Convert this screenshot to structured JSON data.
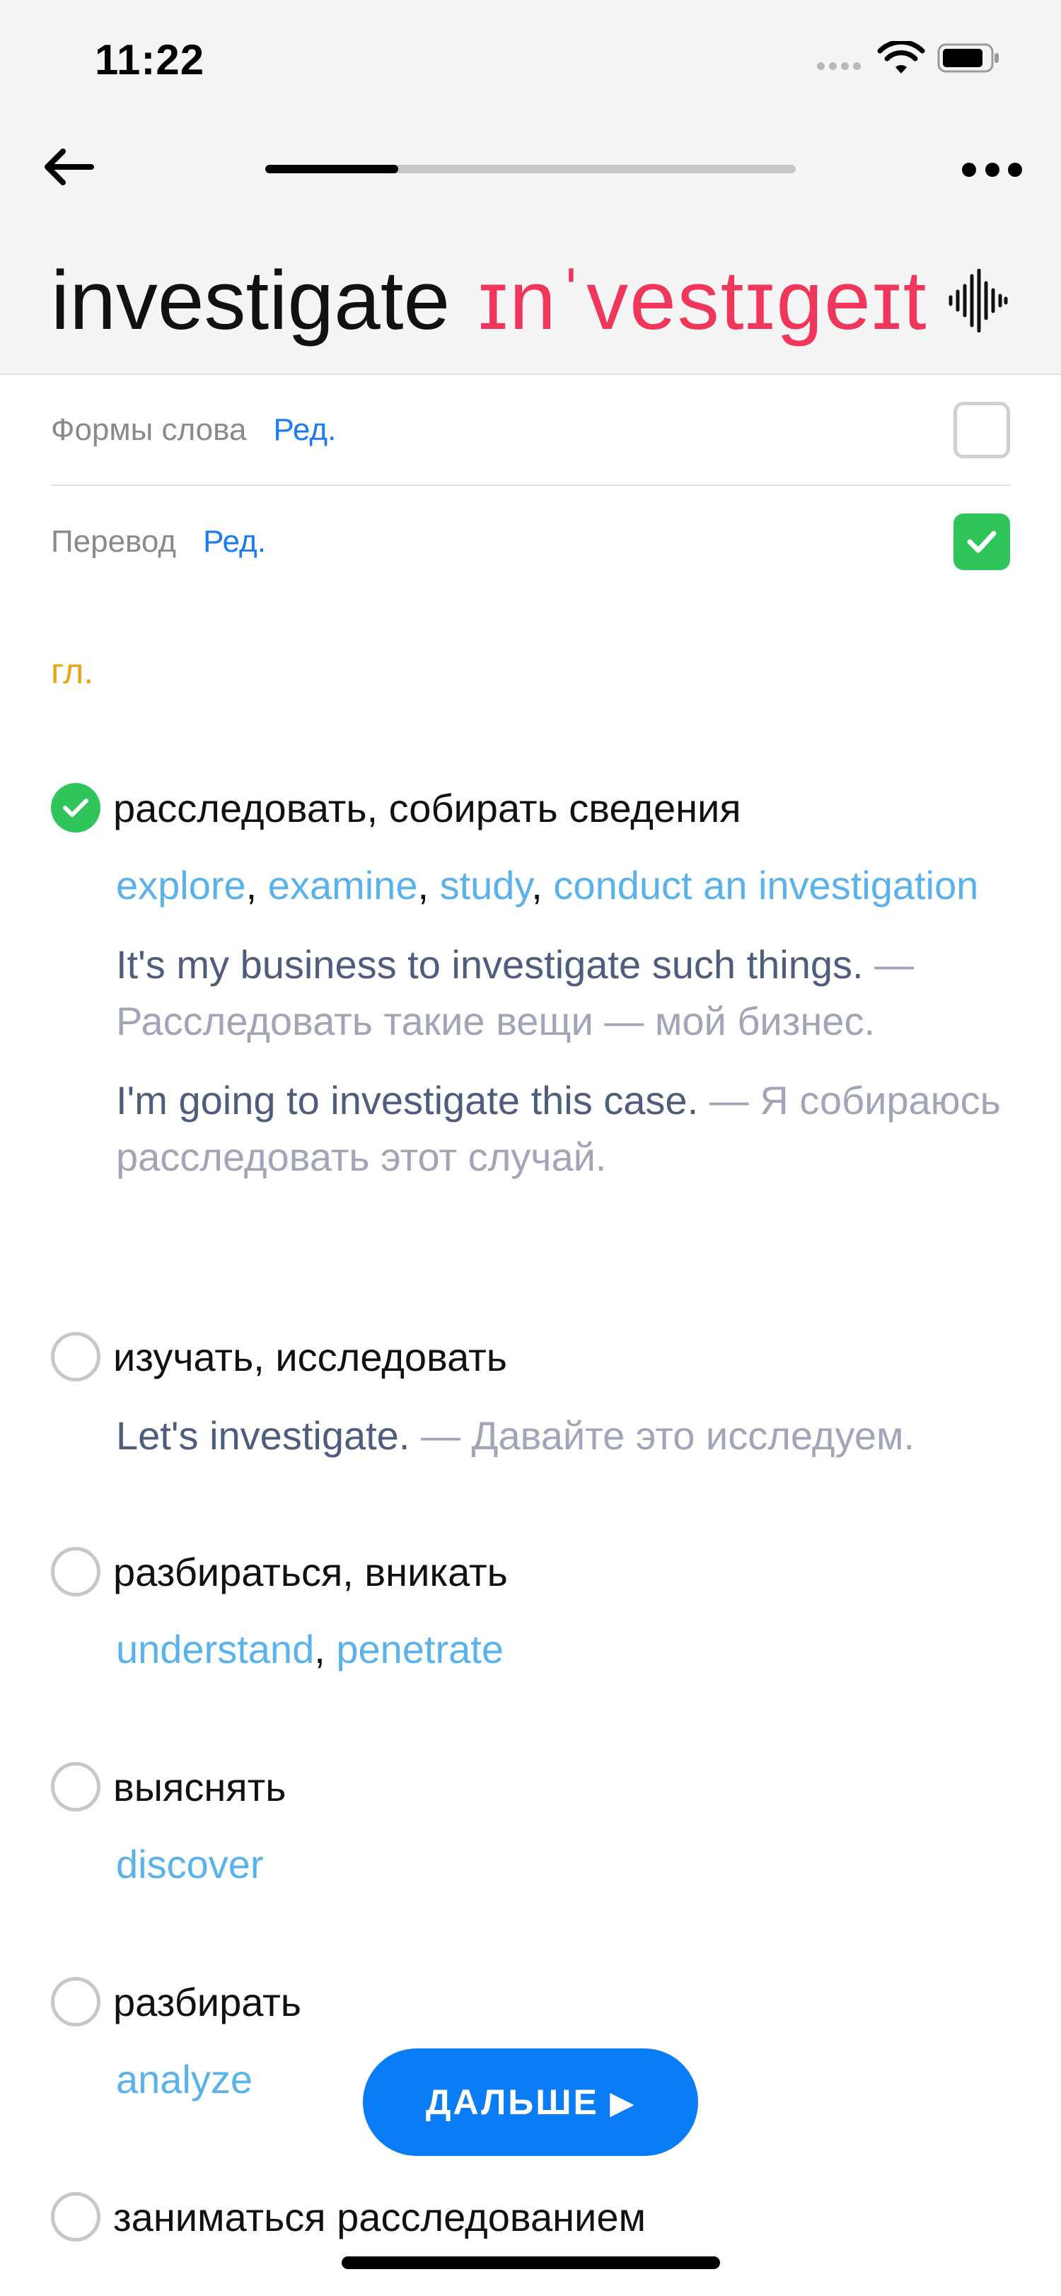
{
  "status_bar": {
    "time": "11:22"
  },
  "header": {
    "word": "investigate",
    "transcription": "ɪnˈvestɪgeɪt",
    "progress": 0.25,
    "back_icon": "arrow-left-icon",
    "more_icon": "more-dots-icon",
    "audio_icon": "sound-wave-icon"
  },
  "toggles": [
    {
      "label": "Формы слова",
      "edit": "Ред.",
      "checked": false
    },
    {
      "label": "Перевод",
      "edit": "Ред.",
      "checked": true
    }
  ],
  "part_of_speech": "гл.",
  "meanings": [
    {
      "text": "расследовать, собирать сведения",
      "selected": true,
      "synonyms": [
        "explore",
        "examine",
        "study",
        "conduct an investigation"
      ],
      "examples": [
        {
          "en": "It's my business to investigate such things.",
          "ru": "Расследовать такие вещи — мой бизнес."
        },
        {
          "en": "I'm going to investigate this case.",
          "ru": "Я собираюсь расследовать этот случай."
        }
      ]
    },
    {
      "text": "изучать, исследовать",
      "selected": false,
      "synonyms": [],
      "examples": [
        {
          "en": "Let's investigate.",
          "ru": "Давайте это исследуем."
        }
      ]
    },
    {
      "text": "разбираться, вникать",
      "selected": false,
      "synonyms": [
        "understand",
        "penetrate"
      ],
      "examples": []
    },
    {
      "text": "выяснять",
      "selected": false,
      "synonyms": [
        "discover"
      ],
      "examples": []
    },
    {
      "text": "разбирать",
      "selected": false,
      "synonyms": [
        "analyze"
      ],
      "examples": []
    },
    {
      "text": "заниматься расследованием",
      "selected": false,
      "synonyms": [],
      "examples": []
    }
  ],
  "next_button": {
    "label": "ДАЛЬШЕ",
    "icon": "play-triangle-icon"
  },
  "colors": {
    "accent": "#0a7cf5",
    "transcription": "#f0365a",
    "check_green": "#2fc55a",
    "synonym": "#5ab2ec",
    "pos": "#eaa516"
  }
}
